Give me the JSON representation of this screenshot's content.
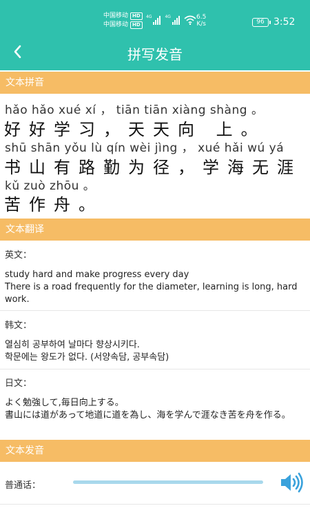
{
  "status_bar": {
    "carrier_1": "中国移动",
    "carrier_2": "中国移动",
    "hd_1": "HD",
    "hd_2": "HD",
    "net_1": "4G",
    "net_2": "4G",
    "speed_value": "6.5",
    "speed_unit": "K/s",
    "battery": "96",
    "time": "3:52"
  },
  "header": {
    "title": "拼写发音",
    "back_icon": "back-arrow-icon"
  },
  "pinyin_section": {
    "title": "文本拼音",
    "lines": [
      {
        "pinyin": "hǎo hǎo xué  xí  ，   tiān tiān xiàng shàng  。",
        "hanzi": "好好学习，天天向 上。"
      },
      {
        "pinyin": "shū shān yǒu  lù  qín wèi jìng  ，  xué hǎi wú yá",
        "hanzi": "书山有路勤为径，学海无涯"
      },
      {
        "pinyin": "kǔ zuò zhōu  。",
        "hanzi": "苦作舟。"
      }
    ]
  },
  "translation_section": {
    "title": "文本翻译",
    "english_label": "英文：",
    "english_text_1": "study hard and make progress every day",
    "english_text_2": "There is a road frequently for the diameter, learning is long, hard work.",
    "korean_label": "韩文：",
    "korean_text_1": "열심히 공부하여 날마다 향상시키다.",
    "korean_text_2": "학문에는 왕도가 없다. (서양속담, 공부속담)",
    "japanese_label": "日文：",
    "japanese_text_1": "よく勉強して,毎日向上する。",
    "japanese_text_2": "書山には道があって地道に道を為し、海を学んで涯なき苦を舟を作る。"
  },
  "audio_section": {
    "title": "文本发音",
    "mandarin_label": "普通话：",
    "speaker_icon": "speaker-icon"
  },
  "colors": {
    "primary": "#2fc1ad",
    "section_header": "#f6bc65",
    "audio_bar": "#a8d8ec",
    "speaker": "#3aa2dc"
  }
}
